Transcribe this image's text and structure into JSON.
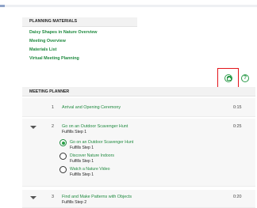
{
  "planning_materials": {
    "header": "PLANNING MATERIALS",
    "links": [
      "Daisy Shapes in Nature Overview",
      "Meeting Overview",
      "Materials List",
      "Virtual Meeting Planning"
    ]
  },
  "toolbar": {
    "print_icon": "printer-icon",
    "help_icon": "question-mark-icon",
    "help_glyph": "?"
  },
  "meeting_planner": {
    "header": "MEETING PLANNER",
    "rows": [
      {
        "number": "1",
        "title": "Arrival and Opening Ceremony",
        "duration": "0:15"
      },
      {
        "number": "2",
        "title": "Go on an Outdoor Scavenger Hunt",
        "subtitle": "Fulfills Step 1",
        "duration": "0:25",
        "options": [
          {
            "title": "Go on an Outdoor Scavenger Hunt",
            "subtitle": "Fulfills Step 1",
            "selected": true
          },
          {
            "title": "Discover Nature Indoors",
            "subtitle": "Fulfills Step 1",
            "selected": false
          },
          {
            "title": "Watch a Nature Video",
            "subtitle": "Fulfills Step 1",
            "selected": false
          }
        ]
      },
      {
        "number": "3",
        "title": "Find and Make Patterns with Objects",
        "subtitle": "Fulfills Step 2",
        "duration": "0:20"
      }
    ]
  },
  "colors": {
    "link_green": "#1f8a3f",
    "highlight_red": "#e3141a",
    "header_bg": "#f2f2f2"
  }
}
